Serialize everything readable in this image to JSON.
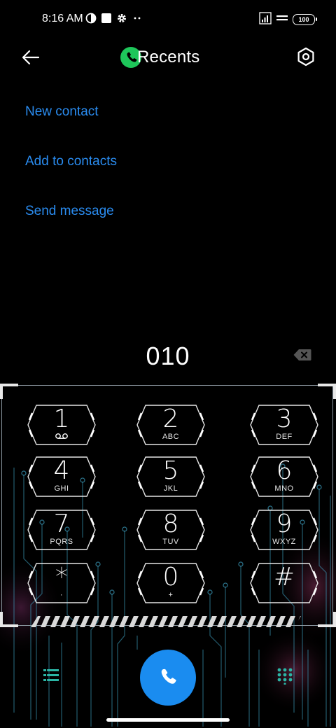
{
  "status_bar": {
    "time": "8:16 AM",
    "battery": "100"
  },
  "header": {
    "title": "Recents",
    "back_icon": "arrow-left-icon",
    "settings_icon": "settings-icon",
    "title_icon": "phone-icon"
  },
  "actions": {
    "new_contact": "New contact",
    "add_to_contacts": "Add to contacts",
    "send_message": "Send message"
  },
  "dialer": {
    "number": "010"
  },
  "keys": [
    {
      "digit": "1",
      "sub": ""
    },
    {
      "digit": "2",
      "sub": "ABC"
    },
    {
      "digit": "3",
      "sub": "DEF"
    },
    {
      "digit": "4",
      "sub": "GHI"
    },
    {
      "digit": "5",
      "sub": "JKL"
    },
    {
      "digit": "6",
      "sub": "MNO"
    },
    {
      "digit": "7",
      "sub": "PQRS"
    },
    {
      "digit": "8",
      "sub": "TUV"
    },
    {
      "digit": "9",
      "sub": "WXYZ"
    },
    {
      "digit": "*",
      "sub": "·"
    },
    {
      "digit": "0",
      "sub": "+"
    },
    {
      "digit": "#",
      "sub": ""
    }
  ],
  "colors": {
    "accent": "#2a8cf0",
    "call_button": "#1a8cf0",
    "phone_badge": "#1ec65a",
    "circuit": "#3fa7c9"
  }
}
